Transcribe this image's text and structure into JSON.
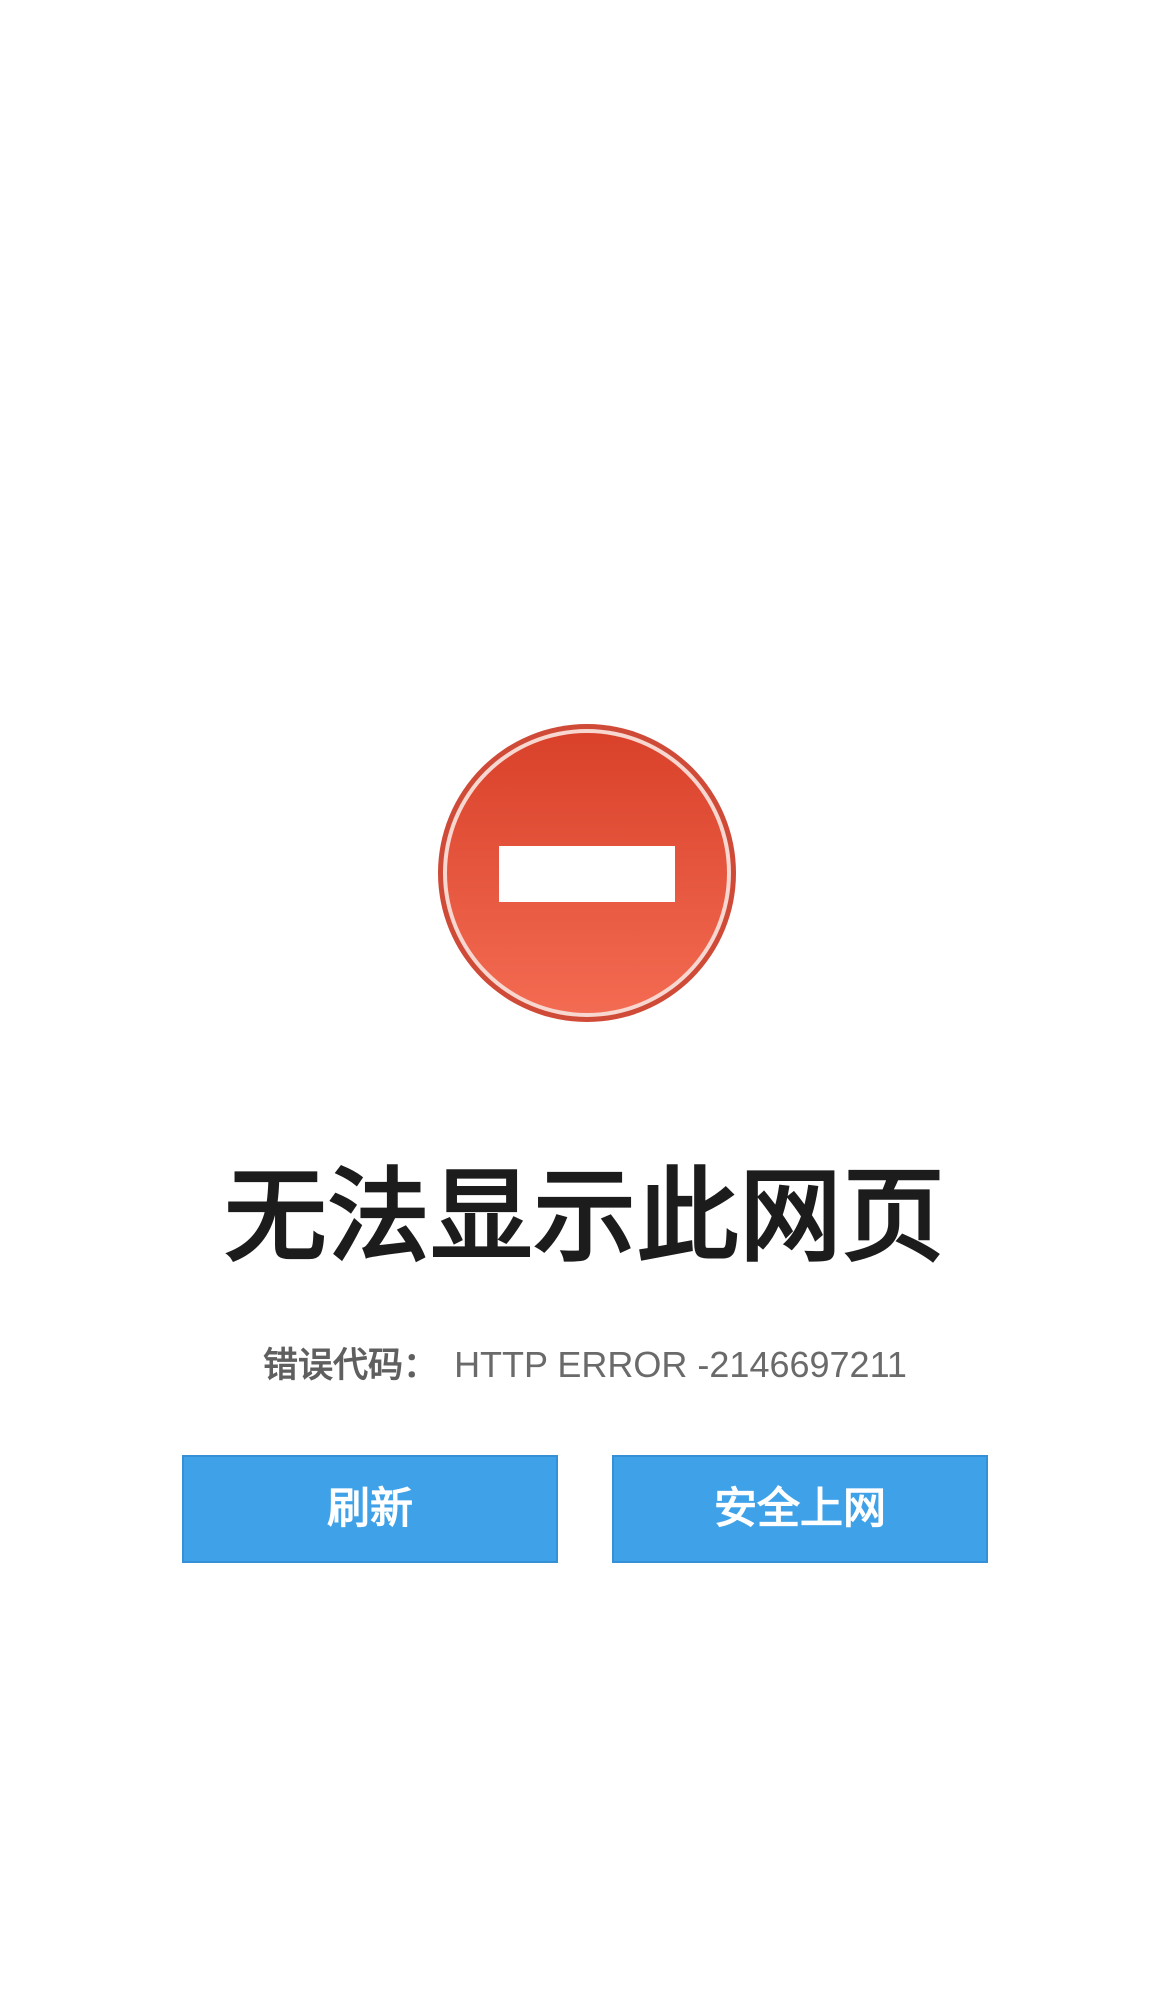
{
  "icon": {
    "name": "stop-icon",
    "outer_color": "#e0513a",
    "inner_top_color": "#d9412a",
    "inner_bottom_color": "#f36b52",
    "bar_color": "#ffffff"
  },
  "title": "无法显示此网页",
  "error": {
    "label": "错误代码",
    "separator": "：",
    "code": "HTTP ERROR -2146697211"
  },
  "buttons": {
    "refresh_label": "刷新",
    "safe_label": "安全上网"
  },
  "colors": {
    "button_bg": "#3fa2e9",
    "title_text": "#1c1c1c",
    "error_text": "#666666"
  }
}
